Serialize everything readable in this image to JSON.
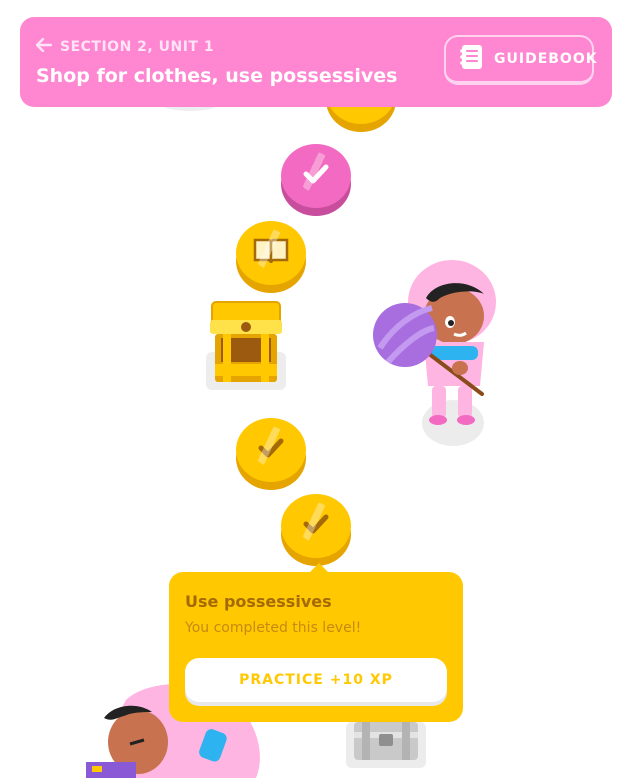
{
  "header": {
    "back_label": "SECTION 2, UNIT 1",
    "title": "Shop for clothes, use possessives",
    "guidebook_label": "GUIDEBOOK",
    "icons": {
      "back": "arrow-left-icon",
      "guidebook": "notebook-icon"
    }
  },
  "path_nodes": [
    {
      "type": "gold-check"
    },
    {
      "type": "pink-check"
    },
    {
      "type": "gold-book"
    },
    {
      "type": "treasure-chest"
    },
    {
      "type": "gold-check"
    },
    {
      "type": "gold-check",
      "selected": true
    },
    {
      "type": "locked-chest"
    }
  ],
  "popover": {
    "title": "Use possessives",
    "subtitle": "You completed this level!",
    "practice_label": "PRACTICE +10 XP"
  },
  "colors": {
    "header_bg": "#ff86d0",
    "gold": "#ffc800",
    "pink": "#f36ac2"
  }
}
